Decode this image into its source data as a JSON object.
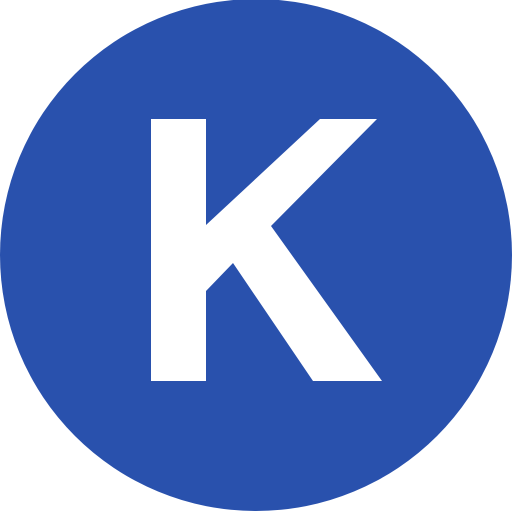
{
  "logo": {
    "letter": "K",
    "background_color": "#2951ad",
    "letter_color": "#ffffff",
    "shape": "circle"
  }
}
